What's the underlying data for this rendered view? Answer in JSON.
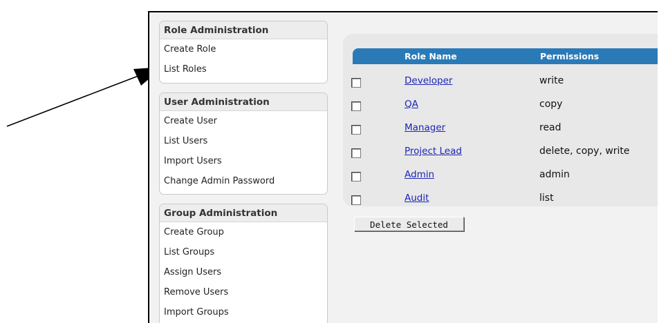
{
  "sidebar": {
    "role_admin": {
      "title": "Role Administration",
      "items": [
        {
          "label": "Create Role"
        },
        {
          "label": "List Roles"
        }
      ]
    },
    "user_admin": {
      "title": "User Administration",
      "items": [
        {
          "label": "Create User"
        },
        {
          "label": "List Users"
        },
        {
          "label": "Import Users"
        },
        {
          "label": "Change Admin Password"
        }
      ]
    },
    "group_admin": {
      "title": "Group Administration",
      "items": [
        {
          "label": "Create Group"
        },
        {
          "label": "List Groups"
        },
        {
          "label": "Assign Users"
        },
        {
          "label": "Remove Users"
        },
        {
          "label": "Import Groups"
        }
      ]
    }
  },
  "roles_table": {
    "columns": [
      "Role Name",
      "Permissions"
    ],
    "rows": [
      {
        "name": "Developer",
        "permissions": "write",
        "checked": false
      },
      {
        "name": "QA",
        "permissions": "copy",
        "checked": false
      },
      {
        "name": "Manager",
        "permissions": "read",
        "checked": false
      },
      {
        "name": "Project Lead",
        "permissions": "delete, copy, write",
        "checked": false
      },
      {
        "name": "Admin",
        "permissions": "admin",
        "checked": false
      },
      {
        "name": "Audit",
        "permissions": "list",
        "checked": false
      }
    ]
  },
  "actions": {
    "delete_selected_label": "Delete Selected"
  },
  "colors": {
    "header_blue": "#2a7ab8",
    "link_blue": "#1a25b5",
    "arrow": "#000000"
  }
}
